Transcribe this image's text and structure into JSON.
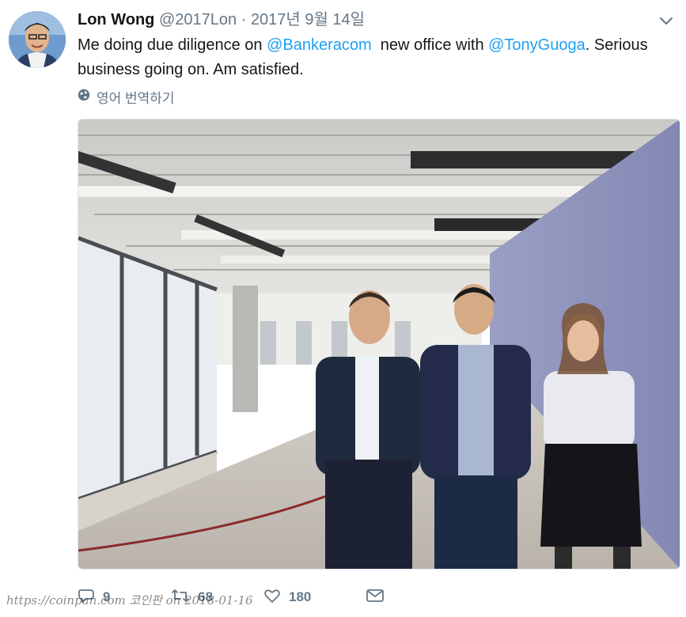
{
  "tweet": {
    "author_name": "Lon Wong",
    "author_handle": "@2017Lon",
    "separator": "·",
    "date": "2017년 9월 14일",
    "text_part1": "Me doing due diligence on ",
    "mention1": "@Bankeracom",
    "text_part2": "  new office with ",
    "mention2": "@TonyGuoga",
    "text_part3": ". Serious business going on. Am satisfied.",
    "translate_label": "영어 번역하기"
  },
  "actions": {
    "reply_count": "9",
    "retweet_count": "68",
    "like_count": "180"
  },
  "watermark": "https://coinpan.com 코인판 on 2018-01-16",
  "colors": {
    "link": "#1da1f2",
    "muted": "#657786",
    "text": "#14171a"
  }
}
